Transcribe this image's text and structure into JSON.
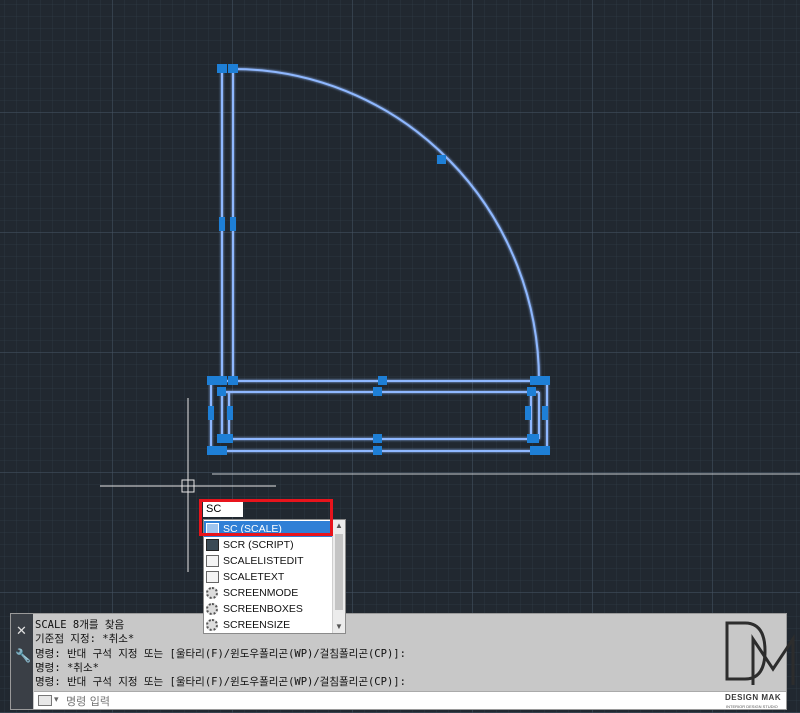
{
  "dynamic_input": {
    "value": "SC"
  },
  "autocomplete": {
    "items": [
      {
        "label": "SC (SCALE)",
        "icon": "scale-icon",
        "selected": true
      },
      {
        "label": "SCR (SCRIPT)",
        "icon": "script-icon",
        "selected": false
      },
      {
        "label": "SCALELISTEDIT",
        "icon": "scalelist-icon",
        "selected": false
      },
      {
        "label": "SCALETEXT",
        "icon": "scaletext-icon",
        "selected": false
      },
      {
        "label": "SCREENMODE",
        "icon": "gear-icon",
        "selected": false
      },
      {
        "label": "SCREENBOXES",
        "icon": "gear-icon",
        "selected": false
      },
      {
        "label": "SCREENSIZE",
        "icon": "gear-icon",
        "selected": false
      }
    ]
  },
  "command_window": {
    "history": [
      "SCALE 8개를 찾음",
      "기준점 지정: *취소*",
      "명령: 반대 구석 지정 또는 [울타리(F)/윈도우폴리곤(WP)/걸침폴리곤(CP)]:",
      "명령: *취소*",
      "명령: 반대 구석 지정 또는 [울타리(F)/윈도우폴리곤(WP)/걸침폴리곤(CP)]:"
    ],
    "input_placeholder": "명령 입력",
    "close_glyph": "✕",
    "wrench_glyph": "🔧"
  },
  "watermark": {
    "logo_letters": "DM",
    "name": "DESIGN MAK",
    "sub": "INTERIOR DESIGN STUDIO"
  },
  "colors": {
    "canvas": "#212830",
    "selection": "#1e7fd6",
    "highlight_box": "#e8141c"
  }
}
